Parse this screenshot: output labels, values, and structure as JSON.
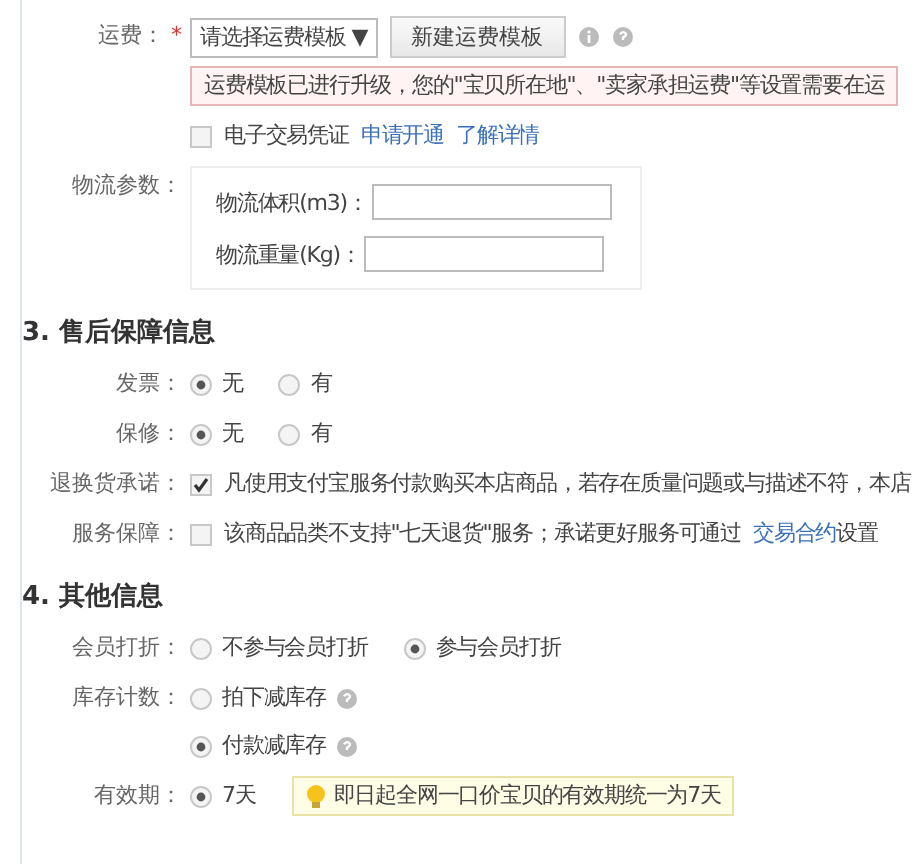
{
  "top_rows": [
    {
      "kind": "freight",
      "label": "运费：",
      "required_mark": "*",
      "select": "请选择运费模板 ▼",
      "button": "新建运费模板",
      "notice": "运费模板已进行升级，您的\"宝贝所在地\"、\"卖家承担运费\"等设置需要在运"
    },
    {
      "kind": "checkbox",
      "label": "",
      "checked": false,
      "text": "电子交易凭证",
      "links": [
        "申请开通",
        "了解详情"
      ]
    },
    {
      "kind": "params",
      "label": "物流参数：",
      "fields": [
        {
          "label": "物流体积(m3)："
        },
        {
          "label": "物流重量(Kg)："
        }
      ]
    }
  ],
  "sections": [
    {
      "heading": "3. 售后保障信息",
      "rows": [
        {
          "kind": "radio",
          "label": "发票：",
          "options": [
            {
              "text": "无",
              "selected": true
            },
            {
              "text": "有",
              "selected": false
            }
          ]
        },
        {
          "kind": "radio",
          "label": "保修：",
          "options": [
            {
              "text": "无",
              "selected": true
            },
            {
              "text": "有",
              "selected": false
            }
          ]
        },
        {
          "kind": "checkbox",
          "label": "退换货承诺：",
          "checked": true,
          "text": "凡使用支付宝服务付款购买本店商品，若存在质量问题或与描述不符，本店"
        },
        {
          "kind": "checkbox",
          "label": "服务保障：",
          "checked": false,
          "text": "该商品品类不支持\"七天退货\"服务；承诺更好服务可通过",
          "links": [
            "交易合约"
          ],
          "suffix": "设置"
        }
      ]
    },
    {
      "heading": "4. 其他信息",
      "rows": [
        {
          "kind": "radio",
          "label": "会员打折：",
          "options": [
            {
              "text": "不参与会员打折",
              "selected": false
            },
            {
              "text": "参与会员打折",
              "selected": true
            }
          ]
        },
        {
          "kind": "radio-stack",
          "label": "库存计数：",
          "options": [
            {
              "text": "拍下减库存",
              "selected": false,
              "help": true
            },
            {
              "text": "付款减库存",
              "selected": true,
              "help": true
            }
          ]
        },
        {
          "kind": "radio",
          "label": "有效期：",
          "options": [
            {
              "text": "7天",
              "selected": true
            }
          ],
          "tip": "即日起全网一口价宝贝的有效期统一为7天"
        }
      ]
    }
  ]
}
